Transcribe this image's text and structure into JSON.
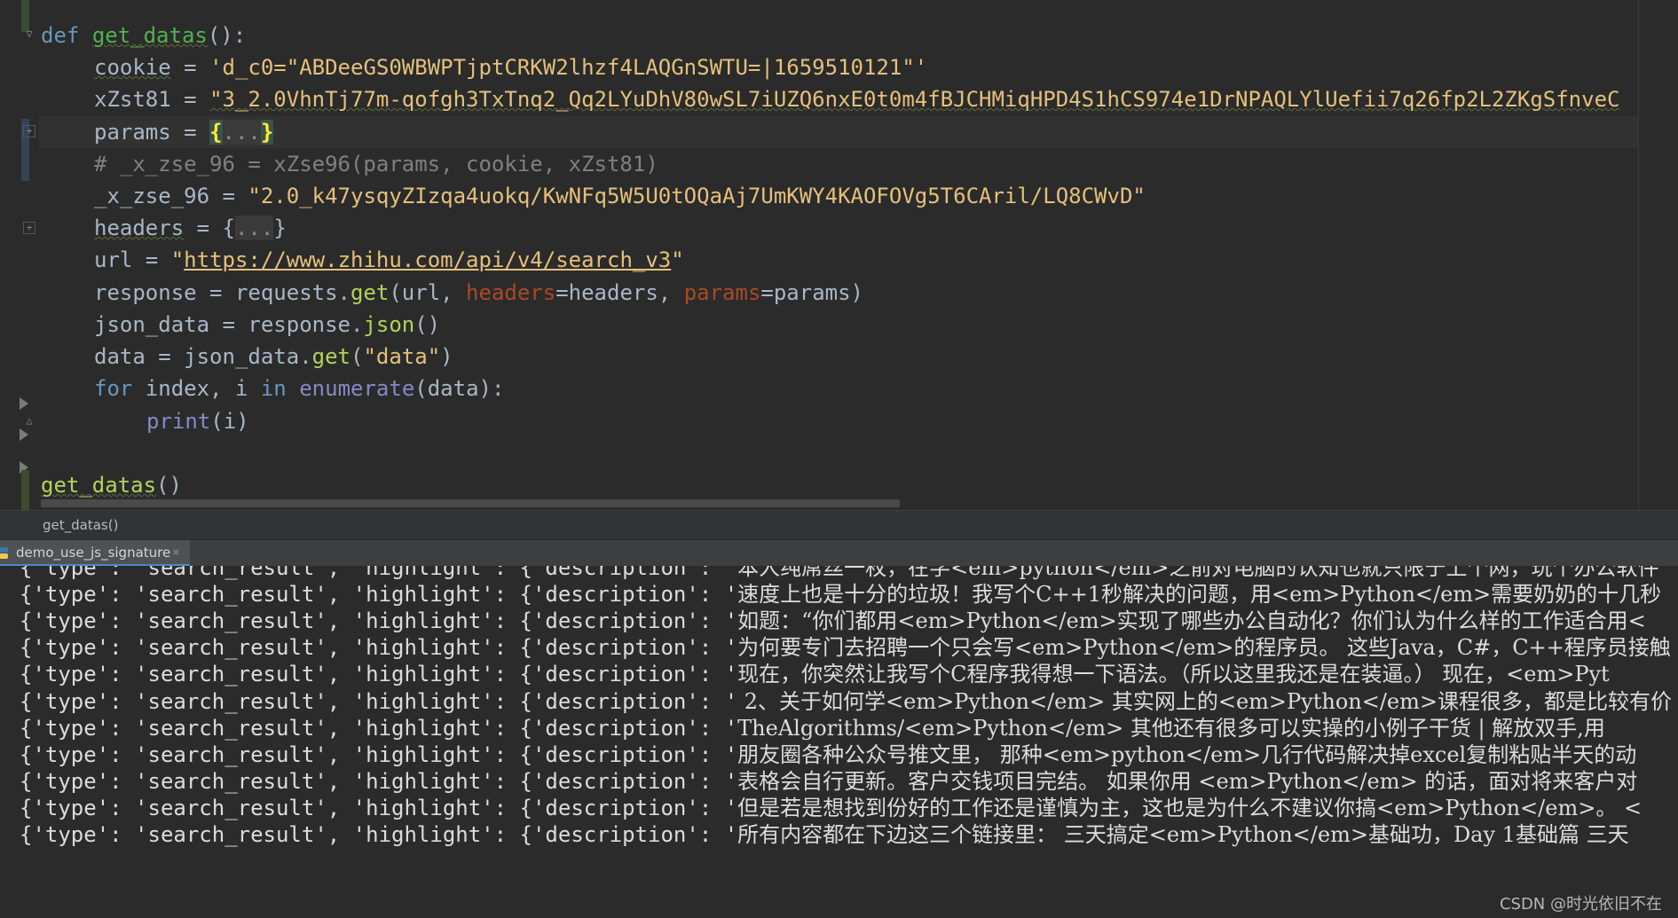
{
  "editor": {
    "lines": {
      "l1": {
        "kw": "def",
        "name": "get_datas",
        "rest": "():"
      },
      "l2": {
        "var": "cookie",
        "op": " = ",
        "str": "'d_c0=\"ABDeeGS0WBWPTjptCRKW2lhzf4LAQGnSWTU=|1659510121\"'"
      },
      "l3": {
        "var": "xZst81",
        "op": " = ",
        "str": "\"3_2.0VhnTj77m-qofgh3TxTnq2_Qq2LYuDhV80wSL7iUZQ6nxE0t0m4fBJCHMiqHPD4S1hCS974e1DrNPAQLYlUefii7q26fp2L2ZKgSfnveC"
      },
      "l4": {
        "var": "params",
        "op": " = ",
        "open": "{",
        "dots": "...",
        "close": "}"
      },
      "l5": {
        "comment": "# _x_zse_96 = xZse96(params, cookie, xZst81)"
      },
      "l6": {
        "var": "_x_zse_96",
        "op": " = ",
        "str_a": "\"2.0_k47ysqyZIzqa4uokq/KwNFq5W5U0tOQaAj7UmKWY4KAOFOVg5T6CAril/LQ8CWvD\""
      },
      "l7": {
        "var": "headers",
        "op": " = {",
        "dots": "...",
        "close": "}"
      },
      "l8": {
        "var": "url",
        "op": " = ",
        "q1": "\"",
        "url": "https://www.zhihu.com/api/v4/search_v3",
        "q2": "\""
      },
      "l9": {
        "a": "response = requests.",
        "get": "get",
        "b": "(url, ",
        "p1": "headers",
        "c": "=headers, ",
        "p2": "params",
        "d": "=params)"
      },
      "l10": {
        "a": "json_data = response.",
        "json": "json",
        "b": "()"
      },
      "l11": {
        "a": "data = json_data.",
        "get": "get",
        "b": "(",
        "s": "\"data\"",
        "c": ")"
      },
      "l12": {
        "for": "for",
        "a": " index, i ",
        "in": "in",
        "sp": " ",
        "enum": "enumerate",
        "b": "(data):"
      },
      "l13": {
        "print": "print",
        "b": "(i)"
      },
      "l15": {
        "call": "get_datas",
        "b": "()"
      }
    }
  },
  "breadcrumb": {
    "text": "get_datas()"
  },
  "run_tab": {
    "label": "demo_use_js_signature",
    "close": "×"
  },
  "console": {
    "prefix": "{'type': 'search_result', 'highlight': {'description': '",
    "lines": [
      "本人纯屌丝一枚，在学<em>python</em>之前对电脑的认知也就只限于上个网，玩个办公软件",
      "速度上也是十分的垃圾！我写个C++1秒解决的问题，用<em>Python</em>需要奶奶的十几秒",
      "如题：“你们都用<em>Python</em>实现了哪些办公自动化？你们认为什么样的工作适合用<",
      "为何要专门去招聘一个只会写<em>Python</em>的程序员。 这些Java，C#，C++程序员接触",
      "现在，你突然让我写个C程序我得想一下语法。（所以这里我还是在装逼。） 现在，<em>Pyt",
      " 2、关于如何学<em>Python</em> 其实网上的<em>Python</em>课程很多，都是比较有价",
      "TheAlgorithms/<em>Python</em> 其他还有很多可以实操的小例子干货 | 解放双手,用",
      "朋友圈各种公众号推文里， 那种<em>python</em>几行代码解决掉excel复制粘贴半天的动",
      "表格会自行更新。客户交钱项目完结。 如果你用 <em>Python</em> 的话，面对将来客户对",
      "但是若是想找到份好的工作还是谨慎为主，这也是为什么不建议你搞<em>Python</em>。 <",
      "所有内容都在下边这三个链接里： 三天搞定<em>Python</em>基础功，Day 1基础篇 三天"
    ]
  },
  "watermark": "CSDN @时光依旧不在",
  "colors": {
    "keyword": "#cc7832",
    "function": "#ffc66d",
    "string": "#6a8759",
    "comment": "#808080",
    "param": "#aa4926",
    "text": "#a9b7c6",
    "background": "#2b2b2b"
  }
}
